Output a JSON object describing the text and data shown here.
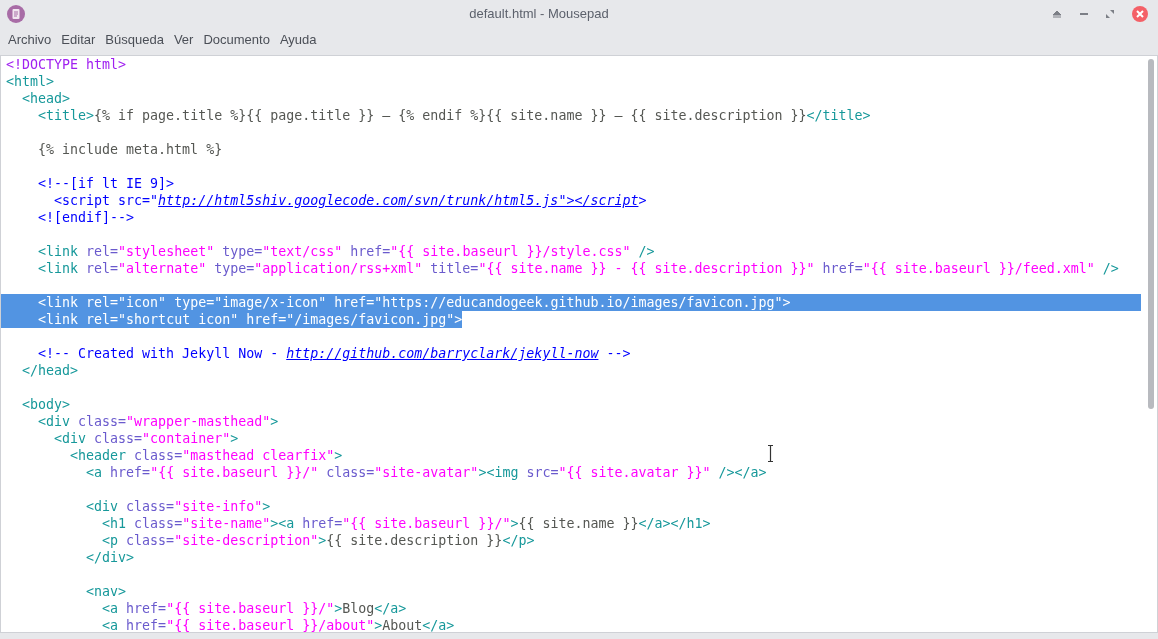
{
  "window": {
    "title": "default.html - Mousepad"
  },
  "menu": [
    "Archivo",
    "Editar",
    "Búsqueda",
    "Ver",
    "Documento",
    "Ayuda"
  ],
  "editor": {
    "lines": [
      {
        "selected": false,
        "tokens": [
          {
            "kind": "doctype",
            "text": "<!DOCTYPE html>"
          }
        ]
      },
      {
        "selected": false,
        "tokens": [
          {
            "kind": "tag",
            "text": "<html>"
          }
        ]
      },
      {
        "selected": false,
        "tokens": [
          {
            "kind": "tag",
            "text": "  <head>"
          }
        ]
      },
      {
        "selected": false,
        "tokens": [
          {
            "kind": "tag",
            "text": "    <title>"
          },
          {
            "kind": "text",
            "text": "{% if page.title %}{{ page.title }} – {% endif %}{{ site.name }} – {{ site.description }}"
          },
          {
            "kind": "tag",
            "text": "</title>"
          }
        ]
      },
      {
        "selected": false
      },
      {
        "selected": false,
        "tokens": [
          {
            "kind": "text",
            "text": "    {% include meta.html %}"
          }
        ]
      },
      {
        "selected": false
      },
      {
        "selected": false,
        "tokens": [
          {
            "kind": "comment",
            "text": "    <!--[if lt IE 9]>"
          }
        ]
      },
      {
        "selected": false,
        "tokens": [
          {
            "kind": "comment",
            "text": "      <script src=\""
          },
          {
            "kind": "link",
            "text": "http://html5shiv.googlecode.com/svn/trunk/html5.js\"></script"
          },
          {
            "kind": "comment",
            "text": ">"
          }
        ]
      },
      {
        "selected": false,
        "tokens": [
          {
            "kind": "comment",
            "text": "    <![endif]-->"
          }
        ]
      },
      {
        "selected": false
      },
      {
        "selected": false,
        "tokens": [
          {
            "kind": "tag",
            "text": "    <link"
          },
          {
            "kind": "attr",
            "text": " rel="
          },
          {
            "kind": "string",
            "text": "\"stylesheet\""
          },
          {
            "kind": "attr",
            "text": " type="
          },
          {
            "kind": "string",
            "text": "\"text/css\""
          },
          {
            "kind": "attr",
            "text": " href="
          },
          {
            "kind": "string",
            "text": "\"{{ site.baseurl }}/style.css\""
          },
          {
            "kind": "tag",
            "text": " />"
          }
        ]
      },
      {
        "selected": false,
        "tokens": [
          {
            "kind": "tag",
            "text": "    <link"
          },
          {
            "kind": "attr",
            "text": " rel="
          },
          {
            "kind": "string",
            "text": "\"alternate\""
          },
          {
            "kind": "attr",
            "text": " type="
          },
          {
            "kind": "string",
            "text": "\"application/rss+xml\""
          },
          {
            "kind": "attr",
            "text": " title="
          },
          {
            "kind": "string",
            "text": "\"{{ site.name }} - {{ site.description }}\""
          },
          {
            "kind": "attr",
            "text": " href="
          },
          {
            "kind": "string",
            "text": "\"{{ site.baseurl }}/feed.xml\""
          },
          {
            "kind": "tag",
            "text": " />"
          }
        ]
      },
      {
        "selected": false
      },
      {
        "selected": true,
        "tokens": [
          {
            "kind": "tag",
            "text": "    <link"
          },
          {
            "kind": "attr",
            "text": " rel="
          },
          {
            "kind": "string",
            "text": "\"icon\""
          },
          {
            "kind": "attr",
            "text": " type="
          },
          {
            "kind": "string",
            "text": "\"image/x-icon\""
          },
          {
            "kind": "attr",
            "text": " href="
          },
          {
            "kind": "string",
            "text": "\"https://educandogeek.github.io/images/favicon.jpg\""
          },
          {
            "kind": "tag",
            "text": ">"
          }
        ]
      },
      {
        "selected": true,
        "tokens": [
          {
            "kind": "tag",
            "text": "    <link"
          },
          {
            "kind": "attr",
            "text": " rel="
          },
          {
            "kind": "string",
            "text": "\"shortcut icon\""
          },
          {
            "kind": "attr",
            "text": " href="
          },
          {
            "kind": "string",
            "text": "\"/images/favicon.jpg\""
          },
          {
            "kind": "tag",
            "text": ">"
          }
        ]
      },
      {
        "selected": false
      },
      {
        "selected": false,
        "tokens": [
          {
            "kind": "comment",
            "text": "    <!-- Created with Jekyll Now - "
          },
          {
            "kind": "link",
            "text": "http://github.com/barryclark/jekyll-now"
          },
          {
            "kind": "comment",
            "text": " -->"
          }
        ]
      },
      {
        "selected": false,
        "tokens": [
          {
            "kind": "tag",
            "text": "  </head>"
          }
        ]
      },
      {
        "selected": false
      },
      {
        "selected": false,
        "tokens": [
          {
            "kind": "tag",
            "text": "  <body>"
          }
        ]
      },
      {
        "selected": false,
        "tokens": [
          {
            "kind": "tag",
            "text": "    <div"
          },
          {
            "kind": "attr",
            "text": " class="
          },
          {
            "kind": "string",
            "text": "\"wrapper-masthead\""
          },
          {
            "kind": "tag",
            "text": ">"
          }
        ]
      },
      {
        "selected": false,
        "tokens": [
          {
            "kind": "tag",
            "text": "      <div"
          },
          {
            "kind": "attr",
            "text": " class="
          },
          {
            "kind": "string",
            "text": "\"container\""
          },
          {
            "kind": "tag",
            "text": ">"
          }
        ]
      },
      {
        "selected": false,
        "tokens": [
          {
            "kind": "tag",
            "text": "        <header"
          },
          {
            "kind": "attr",
            "text": " class="
          },
          {
            "kind": "string",
            "text": "\"masthead clearfix\""
          },
          {
            "kind": "tag",
            "text": ">"
          }
        ]
      },
      {
        "selected": false,
        "tokens": [
          {
            "kind": "tag",
            "text": "          <a"
          },
          {
            "kind": "attr",
            "text": " href="
          },
          {
            "kind": "string",
            "text": "\"{{ site.baseurl }}/\""
          },
          {
            "kind": "attr",
            "text": " class="
          },
          {
            "kind": "string",
            "text": "\"site-avatar\""
          },
          {
            "kind": "tag",
            "text": "><img"
          },
          {
            "kind": "attr",
            "text": " src="
          },
          {
            "kind": "string",
            "text": "\"{{ site.avatar }}\""
          },
          {
            "kind": "tag",
            "text": " /></a>"
          }
        ]
      },
      {
        "selected": false
      },
      {
        "selected": false,
        "tokens": [
          {
            "kind": "tag",
            "text": "          <div"
          },
          {
            "kind": "attr",
            "text": " class="
          },
          {
            "kind": "string",
            "text": "\"site-info\""
          },
          {
            "kind": "tag",
            "text": ">"
          }
        ]
      },
      {
        "selected": false,
        "tokens": [
          {
            "kind": "tag",
            "text": "            <h1"
          },
          {
            "kind": "attr",
            "text": " class="
          },
          {
            "kind": "string",
            "text": "\"site-name\""
          },
          {
            "kind": "tag",
            "text": "><a"
          },
          {
            "kind": "attr",
            "text": " href="
          },
          {
            "kind": "string",
            "text": "\"{{ site.baseurl }}/\""
          },
          {
            "kind": "tag",
            "text": ">"
          },
          {
            "kind": "text",
            "text": "{{ site.name }}"
          },
          {
            "kind": "tag",
            "text": "</a></h1>"
          }
        ]
      },
      {
        "selected": false,
        "tokens": [
          {
            "kind": "tag",
            "text": "            <p"
          },
          {
            "kind": "attr",
            "text": " class="
          },
          {
            "kind": "string",
            "text": "\"site-description\""
          },
          {
            "kind": "tag",
            "text": ">"
          },
          {
            "kind": "text",
            "text": "{{ site.description }}"
          },
          {
            "kind": "tag",
            "text": "</p>"
          }
        ]
      },
      {
        "selected": false,
        "tokens": [
          {
            "kind": "tag",
            "text": "          </div>"
          }
        ]
      },
      {
        "selected": false
      },
      {
        "selected": false,
        "tokens": [
          {
            "kind": "tag",
            "text": "          <nav>"
          }
        ]
      },
      {
        "selected": false,
        "tokens": [
          {
            "kind": "tag",
            "text": "            <a"
          },
          {
            "kind": "attr",
            "text": " href="
          },
          {
            "kind": "string",
            "text": "\"{{ site.baseurl }}/\""
          },
          {
            "kind": "tag",
            "text": ">"
          },
          {
            "kind": "text",
            "text": "Blog"
          },
          {
            "kind": "tag",
            "text": "</a>"
          }
        ]
      },
      {
        "selected": false,
        "tokens": [
          {
            "kind": "tag",
            "text": "            <a"
          },
          {
            "kind": "attr",
            "text": " href="
          },
          {
            "kind": "string",
            "text": "\"{{ site.baseurl }}/about\""
          },
          {
            "kind": "tag",
            "text": ">"
          },
          {
            "kind": "text",
            "text": "About"
          },
          {
            "kind": "tag",
            "text": "</a>"
          }
        ]
      }
    ]
  }
}
